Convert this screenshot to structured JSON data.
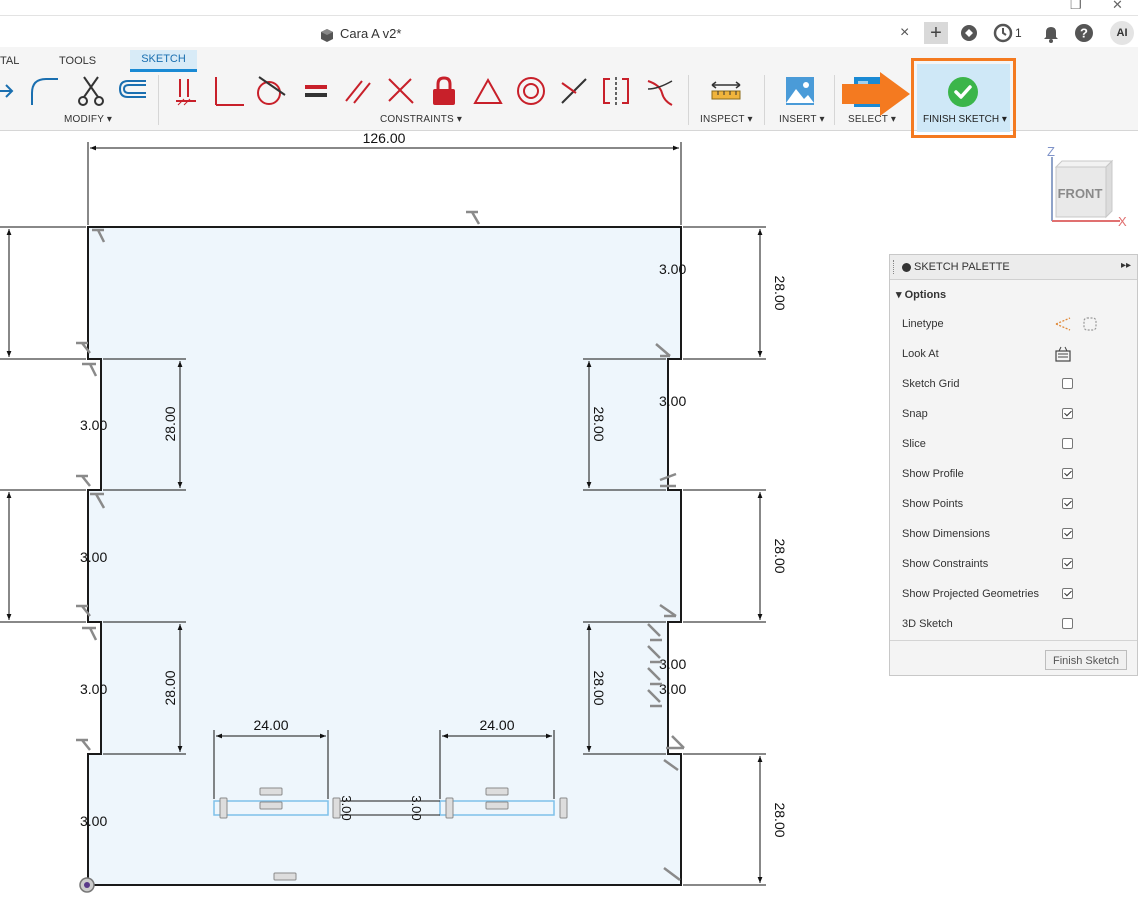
{
  "window": {
    "doc_title": "Cara A v2*",
    "jobs_count": "1",
    "user_initials": "AI",
    "close_tab": "×",
    "new_tab": "+"
  },
  "ribbon": {
    "tabs": [
      "TAL",
      "TOOLS",
      "SKETCH"
    ],
    "groups": {
      "modify": "MODIFY ▾",
      "constraints": "CONSTRAINTS ▾",
      "inspect": "INSPECT ▾",
      "insert": "INSERT ▾",
      "select": "SELECT ▾",
      "finish": "FINISH SKETCH ▾"
    }
  },
  "viewcube": {
    "face": "FRONT",
    "axis_z": "Z",
    "axis_x": "X"
  },
  "dimensions": {
    "top_width": "126.00",
    "d28": "28.00",
    "d3": "3.00",
    "d24": "24.00"
  },
  "palette": {
    "title": "SKETCH PALETTE",
    "section": "Options",
    "options": [
      {
        "label": "Linetype",
        "type": "icons"
      },
      {
        "label": "Look At",
        "type": "icon"
      },
      {
        "label": "Sketch Grid",
        "checked": false
      },
      {
        "label": "Snap",
        "checked": true
      },
      {
        "label": "Slice",
        "checked": false
      },
      {
        "label": "Show Profile",
        "checked": true
      },
      {
        "label": "Show Points",
        "checked": true
      },
      {
        "label": "Show Dimensions",
        "checked": true
      },
      {
        "label": "Show Constraints",
        "checked": true
      },
      {
        "label": "Show Projected Geometries",
        "checked": true
      },
      {
        "label": "3D Sketch",
        "checked": false
      }
    ],
    "finish_button": "Finish Sketch"
  },
  "colors": {
    "accent": "#1a8ad4",
    "highlight_orange": "#f47a20",
    "profile_fill": "#eef6fc",
    "constraint_red": "#c8202a"
  }
}
